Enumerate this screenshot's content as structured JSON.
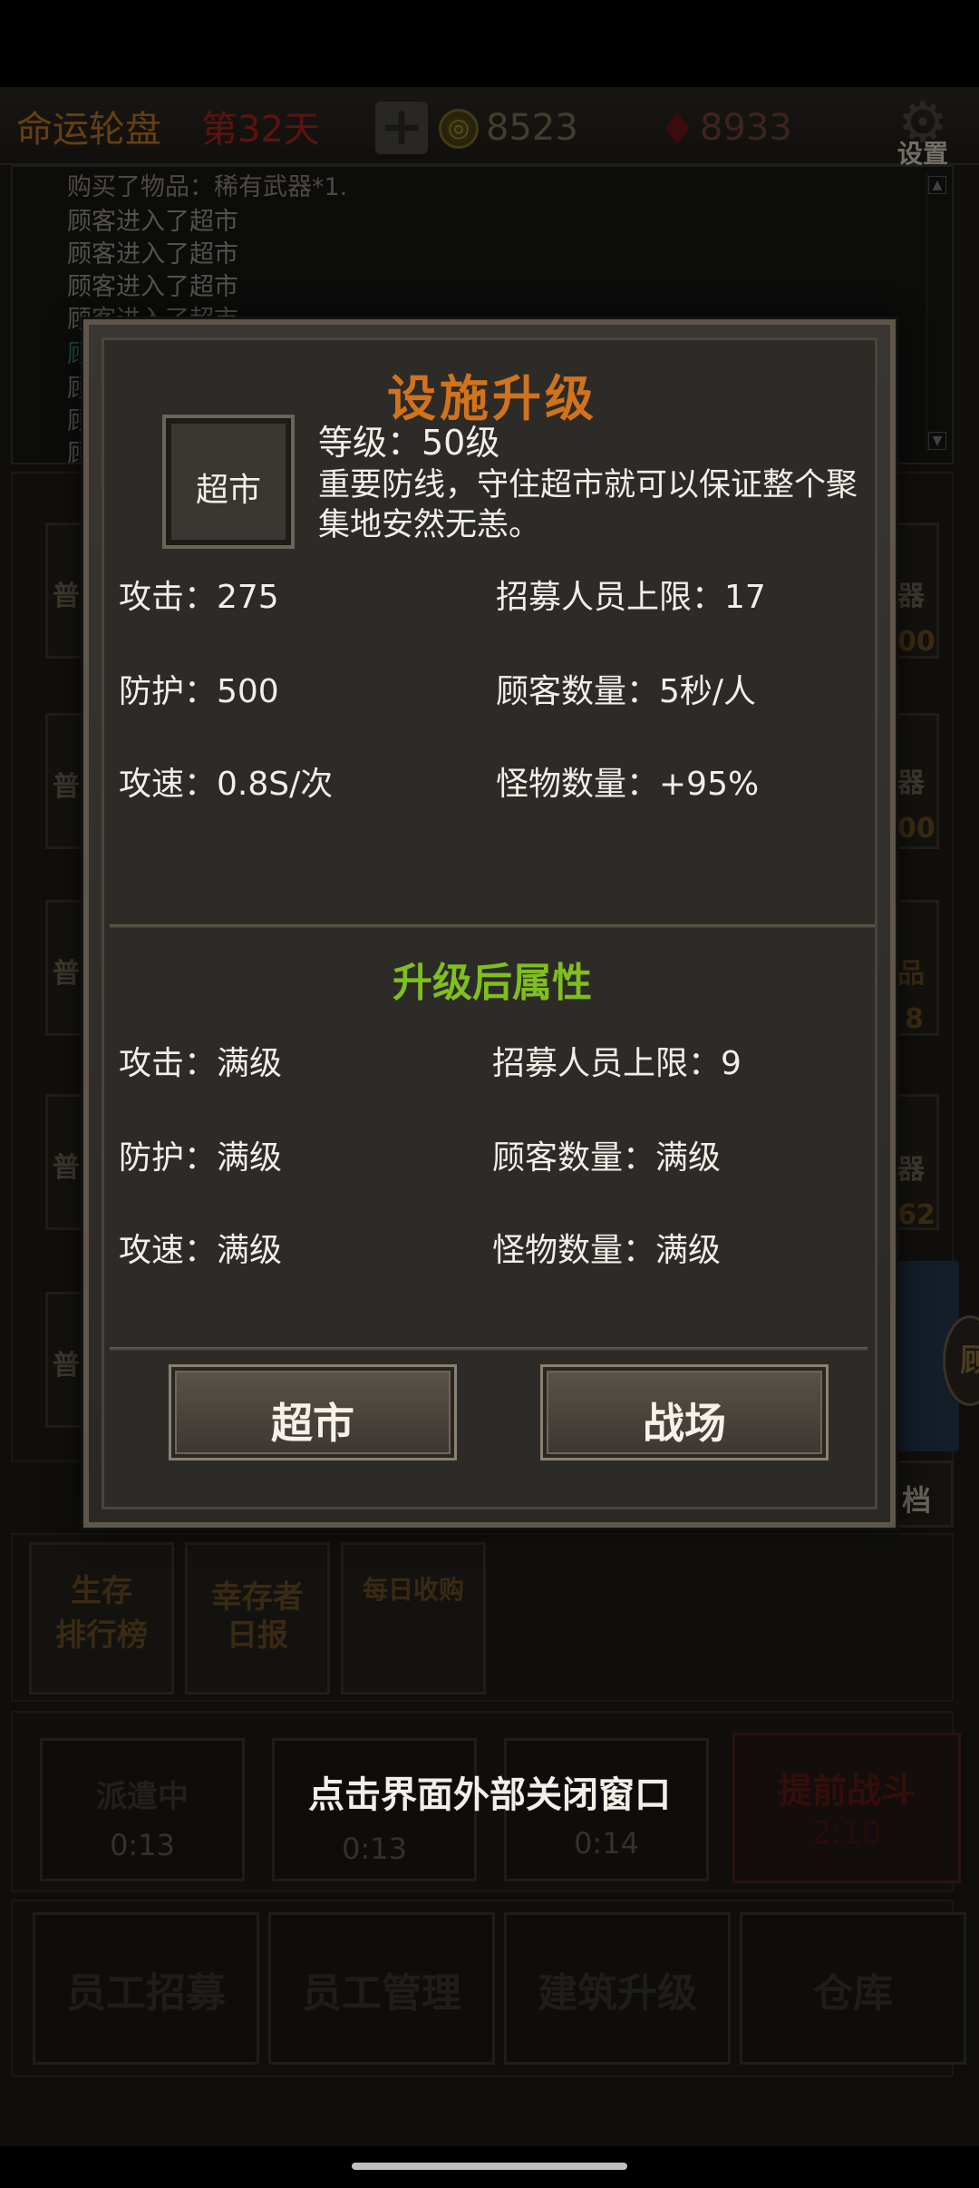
{
  "header": {
    "title": "命运轮盘",
    "day": "第32天",
    "plus_icon": "plus-icon",
    "coin_icon_glyph": "◎",
    "coins": "8523",
    "gem_icon_glyph": "♦",
    "gems": "8933",
    "settings_label": "设置"
  },
  "log": {
    "lines": [
      "购买了物品：稀有武器*1.",
      "顾客进入了超市",
      "顾客进入了超市",
      "顾客进入了超市",
      "顾客进入了超市",
      "顾",
      "顾",
      "顾",
      "顾"
    ]
  },
  "background": {
    "rows": [
      {
        "left": "普",
        "right_top": "器",
        "right_bottom": "00"
      },
      {
        "left": "普",
        "right_top": "器",
        "right_bottom": "00"
      },
      {
        "left": "普",
        "right_top": "品",
        "right_bottom": "8"
      },
      {
        "left": "普",
        "right_top": "器",
        "right_bottom": "62"
      },
      {
        "left": "普",
        "right_top": "",
        "right_bottom": ""
      }
    ],
    "side_tab": "顾",
    "dang": "档",
    "cards": [
      {
        "line1": "生存",
        "line2": "排行榜"
      },
      {
        "line1": "幸存者",
        "line2": "日报"
      },
      {
        "line1": "每日收购",
        "line2": ""
      }
    ],
    "dispatch": [
      {
        "label": "派遣中",
        "time": "0:13"
      },
      {
        "label": "",
        "time": "0:13"
      },
      {
        "label": "",
        "time": "0:14"
      }
    ],
    "early_battle": {
      "label": "提前战斗",
      "time": "2:10"
    },
    "nav_buttons": [
      "员工招募",
      "员工管理",
      "建筑升级",
      "仓库"
    ]
  },
  "dialog": {
    "title": "设施升级",
    "facility": "超市",
    "level": "等级：50级",
    "description": "重要防线，守住超市就可以保证整个聚集地安然无恙。",
    "current": {
      "attack": "攻击：275",
      "defense": "防护：500",
      "speed": "攻速：0.8S/次",
      "recruit": "招募人员上限：17",
      "customers": "顾客数量：5秒/人",
      "monsters": "怪物数量：+95%"
    },
    "after_title": "升级后属性",
    "after": {
      "attack": "攻击：满级",
      "defense": "防护：满级",
      "speed": "攻速：满级",
      "recruit": "招募人员上限：9",
      "customers": "顾客数量：满级",
      "monsters": "怪物数量：满级"
    },
    "buttons": {
      "left": "超市",
      "right": "战场"
    }
  },
  "close_hint": "点击界面外部关闭窗口"
}
